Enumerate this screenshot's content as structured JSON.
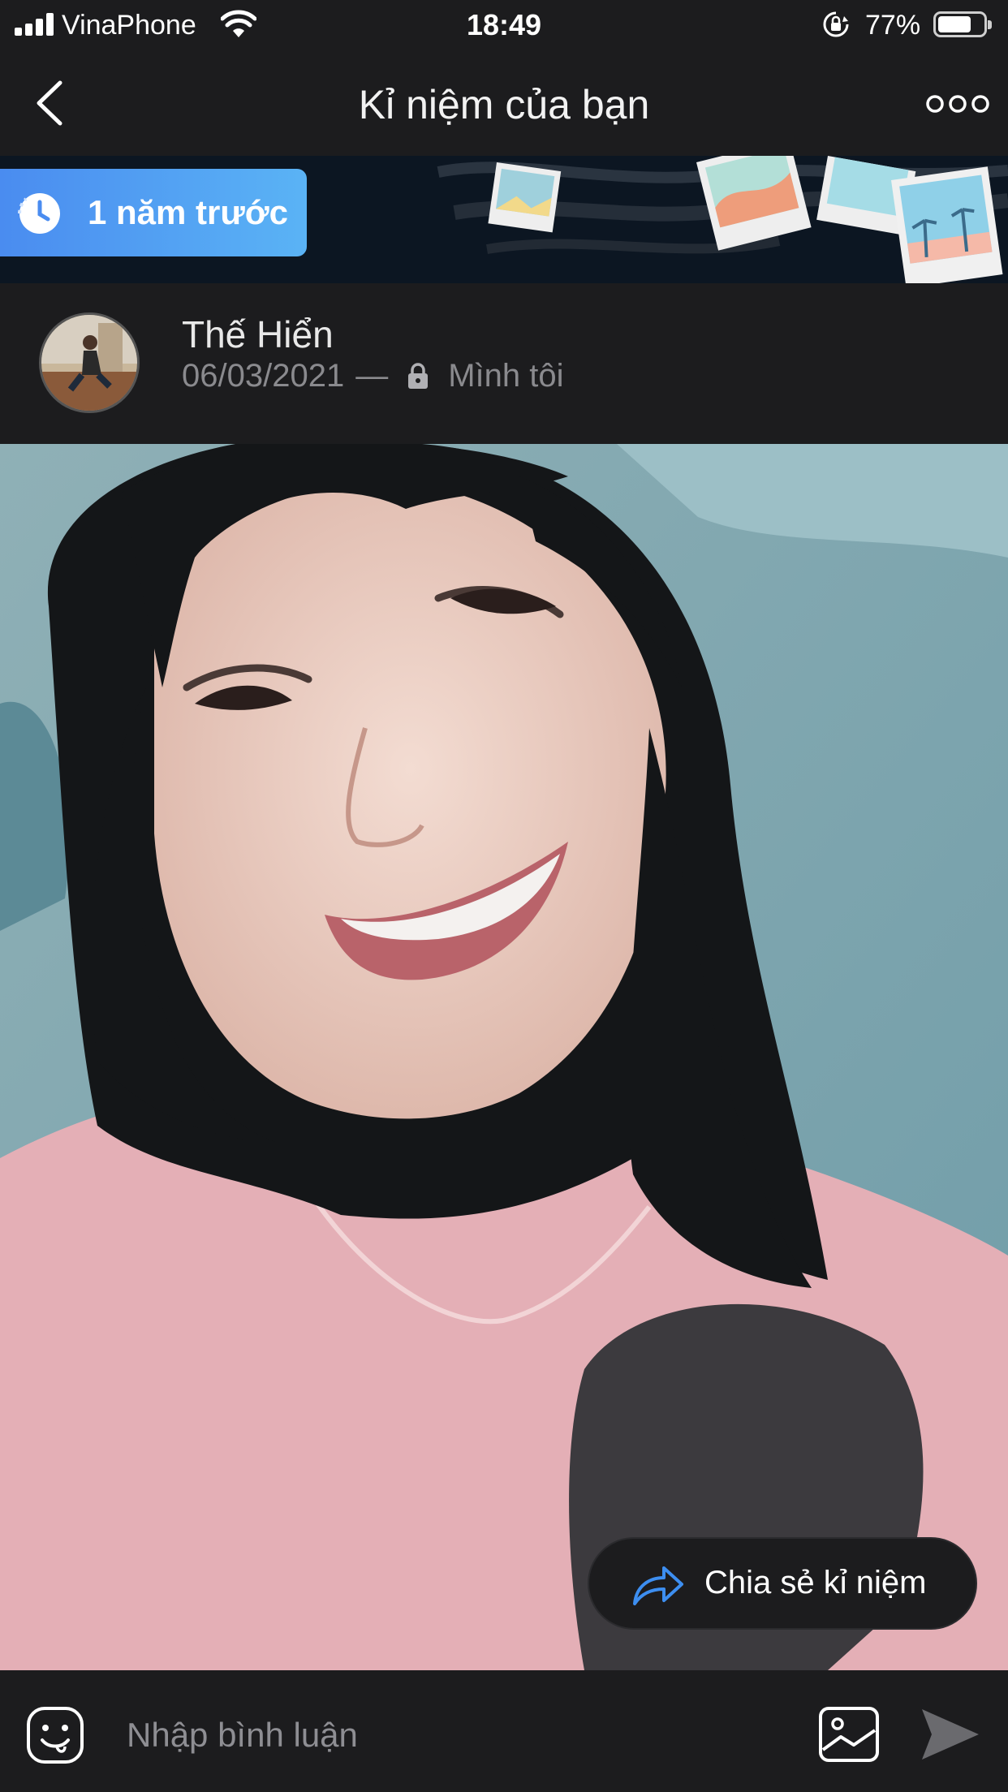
{
  "status_bar": {
    "carrier": "VinaPhone",
    "time": "18:49",
    "battery_percent": "77%",
    "battery_level": 0.77,
    "icons": [
      "signal-icon",
      "wifi-icon",
      "orientation-lock-icon",
      "battery-icon"
    ]
  },
  "nav": {
    "title": "Kỉ niệm của bạn",
    "back_icon": "chevron-left-icon",
    "more_icon": "more-dots-icon"
  },
  "banner": {
    "time_ago_label": "1 năm trước",
    "icon": "history-clock-icon"
  },
  "post": {
    "author_name": "Thế Hiển",
    "date": "06/03/2021",
    "separator": "—",
    "privacy_label": "Mình tôi",
    "privacy_icon": "lock-icon"
  },
  "actions": {
    "share_label": "Chia sẻ kỉ niệm",
    "share_icon": "share-arrow-icon"
  },
  "comment_bar": {
    "placeholder": "Nhập bình luận",
    "icons": [
      "emoji-icon",
      "image-icon",
      "send-icon"
    ]
  },
  "colors": {
    "background": "#1c1c1e",
    "accent_blue": "#4a8cf0",
    "share_icon_blue": "#3d8ef0",
    "muted_text": "#8a8a8e"
  }
}
